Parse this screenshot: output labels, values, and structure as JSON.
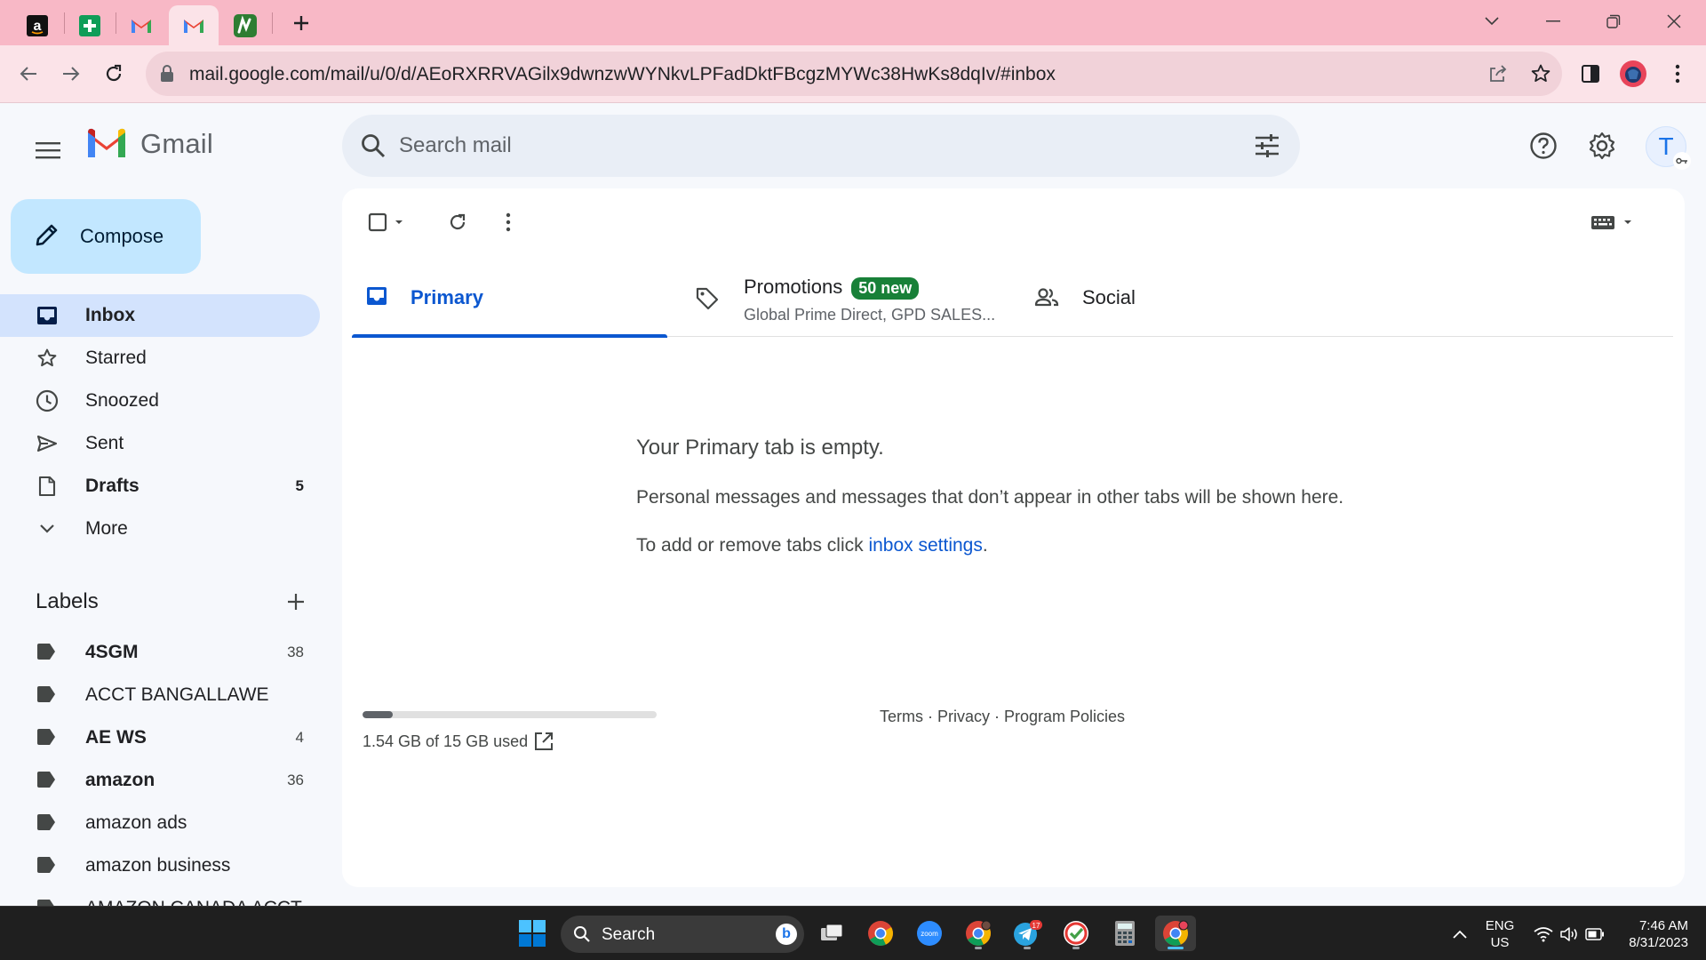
{
  "browser": {
    "url": "mail.google.com/mail/u/0/d/AEoRXRRVAGilx9dwnzwWYNkvLPFadDktFBcgzMYWc38HwKs8dqIv/#inbox",
    "tabs": [
      {
        "icon": "amazon-favicon"
      },
      {
        "icon": "sheets-favicon"
      },
      {
        "icon": "gmail-favicon"
      },
      {
        "icon": "gmail-favicon",
        "active": true
      },
      {
        "icon": "app-favicon"
      }
    ]
  },
  "gmail": {
    "logo_text": "Gmail",
    "search_placeholder": "Search mail",
    "avatar_initial": "T",
    "compose_label": "Compose",
    "nav": [
      {
        "label": "Inbox",
        "count": "",
        "icon": "inbox-icon",
        "active": true
      },
      {
        "label": "Starred",
        "count": "",
        "icon": "star-icon"
      },
      {
        "label": "Snoozed",
        "count": "",
        "icon": "clock-icon"
      },
      {
        "label": "Sent",
        "count": "",
        "icon": "send-icon"
      },
      {
        "label": "Drafts",
        "count": "5",
        "icon": "draft-icon",
        "bold": true
      },
      {
        "label": "More",
        "count": "",
        "icon": "chevron-down-icon"
      }
    ],
    "labels_title": "Labels",
    "labels": [
      {
        "label": "4SGM",
        "count": "38",
        "bold": true
      },
      {
        "label": "ACCT BANGALLAWE",
        "count": ""
      },
      {
        "label": "AE WS",
        "count": "4",
        "bold": true
      },
      {
        "label": "amazon",
        "count": "36",
        "bold": true
      },
      {
        "label": "amazon ads",
        "count": ""
      },
      {
        "label": "amazon business",
        "count": ""
      },
      {
        "label": "AMAZON CANADA ACCT",
        "count": ""
      }
    ],
    "inbox_tabs": {
      "primary": {
        "title": "Primary"
      },
      "promotions": {
        "title": "Promotions",
        "badge": "50 new",
        "subtitle": "Global Prime Direct, GPD SALES..."
      },
      "social": {
        "title": "Social"
      }
    },
    "empty_state": {
      "heading": "Your Primary tab is empty.",
      "line1": "Personal messages and messages that don’t appear in other tabs will be shown here.",
      "line2_prefix": "To add or remove tabs click ",
      "line2_link": "inbox settings",
      "line2_suffix": "."
    },
    "storage": {
      "text": "1.54 GB of 15 GB used",
      "used_fraction": 0.103
    },
    "footer": {
      "terms": "Terms",
      "sep": " · ",
      "privacy": "Privacy",
      "policies": "Program Policies"
    }
  },
  "taskbar": {
    "search_label": "Search",
    "telegram_badge": "17",
    "lang_line1": "ENG",
    "lang_line2": "US",
    "time": "7:46 AM",
    "date": "8/31/2023"
  },
  "colors": {
    "tabbar": "#f8b8c6",
    "toolbar": "#fbe3e8",
    "compose": "#c2e7ff",
    "active_nav": "#d3e3fd",
    "primary_blue": "#0b57d0",
    "badge_green": "#188038"
  }
}
